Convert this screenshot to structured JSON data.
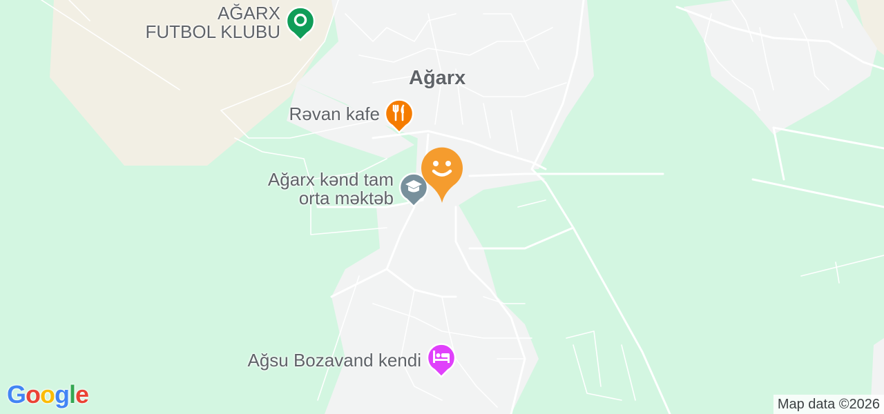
{
  "map": {
    "place_name": "Ağarx",
    "colors": {
      "background": "#d3f6e1",
      "urban": "#f2f3f3",
      "field": "#f2efe4",
      "road": "#ffffff",
      "label": "#5f6368"
    },
    "pois": [
      {
        "id": "football_club",
        "lines": [
          "AĞARX",
          "FUTBOL KLUBU"
        ],
        "icon": "circle-dot-icon",
        "color": "#0f9d58"
      },
      {
        "id": "cafe",
        "lines": [
          "Rəvan kafe"
        ],
        "icon": "fork-knife-icon",
        "color": "#f57c00"
      },
      {
        "id": "school",
        "lines": [
          "Ağarx kənd tam",
          "orta məktəb"
        ],
        "icon": "graduation-cap-icon",
        "color": "#78909c"
      },
      {
        "id": "hotel",
        "lines": [
          "Ağsu Bozavand kendi"
        ],
        "icon": "bed-icon",
        "color": "#e040fb"
      }
    ],
    "marker": {
      "icon": "smiley-face-icon",
      "color": "#f59c2e"
    }
  },
  "attribution": "Map data ©2026",
  "logo": {
    "text": "Google",
    "letters": [
      {
        "ch": "G",
        "color": "#4285f4"
      },
      {
        "ch": "o",
        "color": "#ea4335"
      },
      {
        "ch": "o",
        "color": "#fbbc05"
      },
      {
        "ch": "g",
        "color": "#4285f4"
      },
      {
        "ch": "l",
        "color": "#34a853"
      },
      {
        "ch": "e",
        "color": "#ea4335"
      }
    ]
  }
}
